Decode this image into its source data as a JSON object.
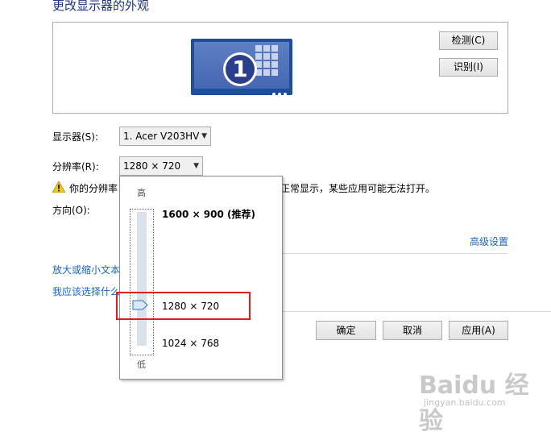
{
  "title": "更改显示器的外观",
  "buttons": {
    "detect": "检测(C)",
    "identify": "识别(I)",
    "ok": "确定",
    "cancel": "取消",
    "apply": "应用(A)"
  },
  "monitor_number": "1",
  "display": {
    "label": "显示器(S):",
    "value": "1. Acer V203HV"
  },
  "resolution": {
    "label": "分辨率(R):",
    "value": "1280 × 720"
  },
  "warning": {
    "prefix": "你的分辨率",
    "suffix": "正常显示，某些应用可能无法打开。"
  },
  "orientation": {
    "label": "方向(O):"
  },
  "advanced_link": "高级设置",
  "links": {
    "zoom_text": "放大或缩小文本",
    "which_choose": "我应该选择什么"
  },
  "popup": {
    "high_label": "高",
    "low_label": "低",
    "options": [
      {
        "label": "1600 × 900 (推荐)",
        "bold": true
      },
      {
        "label": "1280 × 720",
        "bold": false
      },
      {
        "label": "1024 × 768",
        "bold": false
      }
    ],
    "selected_index": 1
  },
  "watermark": {
    "brand": "Baidu 经验",
    "url": "jingyan.baidu.com"
  }
}
